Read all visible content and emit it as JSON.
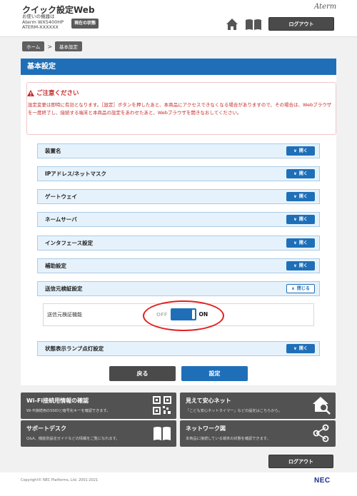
{
  "header": {
    "app_title": "クイック設定Web",
    "device_lines": [
      "お使いの機器は",
      "Aterm WX5400HP",
      "ATERM-XXXXXX"
    ],
    "status_button": "現在の状態",
    "brand": "Aterm",
    "logout": "ログアウト"
  },
  "breadcrumb": {
    "home": "ホーム",
    "separator": ">",
    "current": "基本設定"
  },
  "page": {
    "title": "基本設定",
    "warning_title": "ご注意ください",
    "warning_text": "設定変更は即時に有効となります。［設定］ボタンを押したあと、本商品にアクセスできなくなる場合がありますので、その場合は、Webブラウザを一度終了し、接続する端末と本商品の設定をあわせたあと、Webブラウザを開きなおしてください。"
  },
  "accordion": {
    "open_label": "開く",
    "close_label": "閉じる",
    "items": [
      {
        "label": "装置名"
      },
      {
        "label": "IPアドレス/ネットマスク"
      },
      {
        "label": "ゲートウェイ"
      },
      {
        "label": "ネームサーバ"
      },
      {
        "label": "インタフェース設定"
      },
      {
        "label": "補助設定"
      },
      {
        "label": "送信元検証設定"
      },
      {
        "label": "状態表示ランプ点灯設定"
      }
    ],
    "expanded": {
      "feature_label": "送信元検証機能",
      "off_label": "OFF",
      "on_label": "ON",
      "state": "ON"
    }
  },
  "actions": {
    "back": "戻る",
    "apply": "設定"
  },
  "tiles": [
    {
      "title": "Wi-Fi接続用情報の確認",
      "sub": "Wi-Fi接続用のSSIDと暗号化キーを確認できます。",
      "icon": "qr-code-icon"
    },
    {
      "title": "見えて安心ネット",
      "sub": "「こども安心ネットタイマー」などの設定はこちらから。",
      "icon": "home-search-icon"
    },
    {
      "title": "サポートデスク",
      "sub": "Q&A、機能別設定ガイドなどの情報をご覧になれます。",
      "icon": "book-icon"
    },
    {
      "title": "ネットワーク図",
      "sub": "本商品に接続している端末の状態を確認できます。",
      "icon": "network-icon"
    }
  ],
  "footer": {
    "logout": "ログアウト",
    "copyright": "Copyright© NEC Platforms, Ltd. 2001-2021",
    "logo": "NEC"
  },
  "colors": {
    "accent": "#1f6fb8",
    "warning": "#c52a2a",
    "dark_button": "#4a4a4a",
    "panel_tint": "#e6f2fb"
  }
}
